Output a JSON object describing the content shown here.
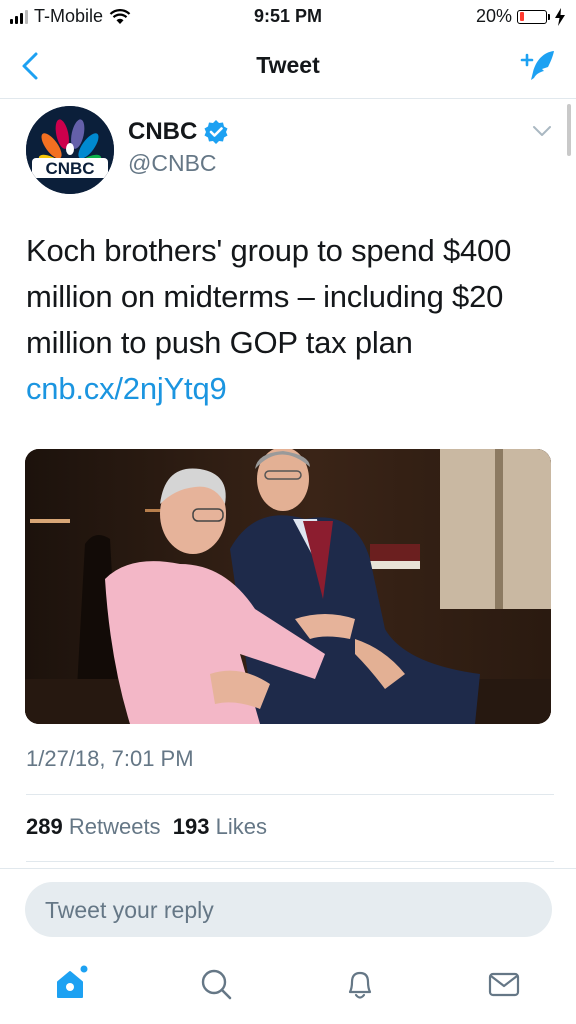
{
  "status": {
    "carrier": "T-Mobile",
    "time": "9:51 PM",
    "battery_percent": "20%",
    "battery_level": 0.2
  },
  "nav": {
    "title": "Tweet",
    "back_icon": "chevron-left-icon",
    "compose_icon": "compose-tweet-icon"
  },
  "tweet": {
    "author_name": "CNBC",
    "author_handle": "@CNBC",
    "avatar_label": "CNBC",
    "text": "Koch brothers' group to spend $400 million on midterms – including $20 million to push GOP tax plan",
    "link": "cnb.cx/2njYtq9",
    "timestamp": "1/27/18, 7:01 PM",
    "retweets_count": "289",
    "retweets_label": "Retweets",
    "likes_count": "193",
    "likes_label": "Likes"
  },
  "reply": {
    "placeholder": "Tweet your reply"
  },
  "tabs": [
    {
      "name": "home",
      "icon": "home-icon",
      "active": true
    },
    {
      "name": "search",
      "icon": "search-icon",
      "active": false
    },
    {
      "name": "notifications",
      "icon": "bell-icon",
      "active": false
    },
    {
      "name": "messages",
      "icon": "mail-icon",
      "active": false
    }
  ],
  "colors": {
    "accent": "#1da1f2",
    "link": "#1b95e0",
    "secondary_text": "#657786",
    "divider": "#e1e8ed"
  }
}
